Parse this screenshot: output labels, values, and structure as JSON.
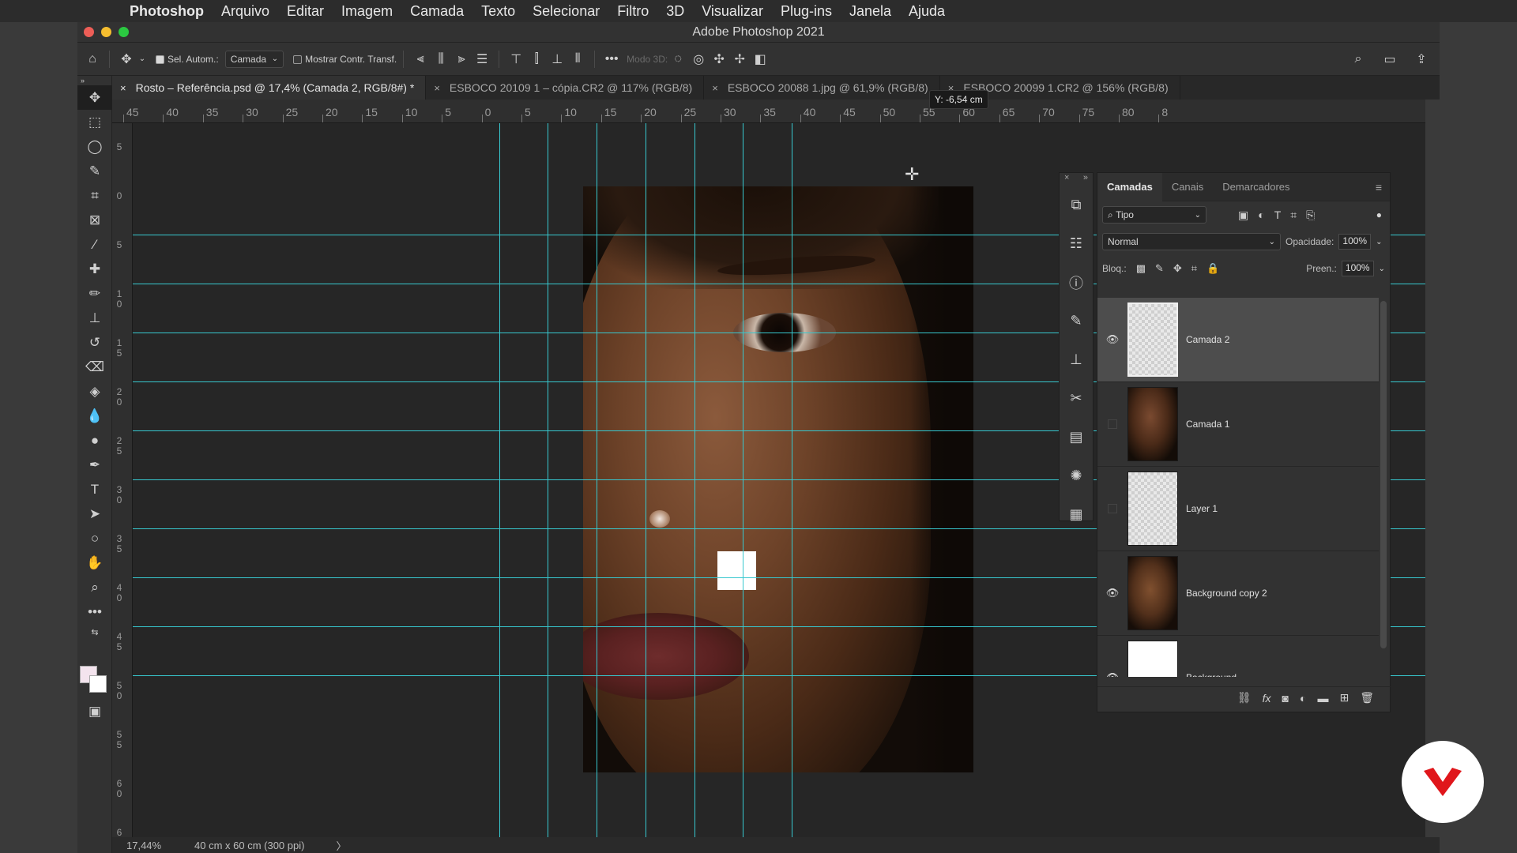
{
  "menubar": {
    "app_name": "Photoshop",
    "items": [
      "Arquivo",
      "Editar",
      "Imagem",
      "Camada",
      "Texto",
      "Selecionar",
      "Filtro",
      "3D",
      "Visualizar",
      "Plug-ins",
      "Janela",
      "Ajuda"
    ]
  },
  "window": {
    "title": "Adobe Photoshop 2021"
  },
  "options": {
    "auto_select_label": "Sel. Autom.:",
    "auto_select_target": "Camada",
    "show_transform_label": "Mostrar Contr. Transf.",
    "mode_3d_label": "Modo 3D:"
  },
  "tabs": [
    {
      "label": "Rosto – Referência.psd @ 17,4% (Camada 2, RGB/8#) *",
      "active": true
    },
    {
      "label": "ESBOCO 20109 1 – cópia.CR2 @ 117% (RGB/8)",
      "active": false
    },
    {
      "label": "ESBOCO 20088 1.jpg @ 61,9% (RGB/8)",
      "active": false
    },
    {
      "label": "ESBOCO 20099 1.CR2 @ 156% (RGB/8)",
      "active": false
    }
  ],
  "ruler_h_labels": [
    "45",
    "40",
    "35",
    "30",
    "25",
    "20",
    "15",
    "10",
    "5",
    "0",
    "5",
    "10",
    "15",
    "20",
    "25",
    "30",
    "35",
    "40",
    "45",
    "50",
    "55",
    "60",
    "65",
    "70",
    "75",
    "80",
    "8"
  ],
  "ruler_v_labels": [
    "5",
    "0",
    "5",
    "10",
    "15",
    "20",
    "25",
    "30",
    "35",
    "40",
    "45",
    "50",
    "55",
    "60",
    "6"
  ],
  "tooltip": "Y: -6,54 cm",
  "status": {
    "zoom": "17,44%",
    "doc_size": "40 cm x 60 cm (300 ppi)",
    "arrow": "〉"
  },
  "layers_panel": {
    "tabs": [
      "Camadas",
      "Canais",
      "Demarcadores"
    ],
    "filter_kind": "Tipo",
    "blend_mode": "Normal",
    "opacity_label": "Opacidade:",
    "opacity_value": "100%",
    "lock_label": "Bloq.:",
    "fill_label": "Preen.:",
    "fill_value": "100%",
    "layers": [
      {
        "name": "Camada 2",
        "visible": true,
        "selected": true,
        "thumb": "transparent"
      },
      {
        "name": "Camada 1",
        "visible": false,
        "selected": false,
        "thumb": "face1"
      },
      {
        "name": "Layer 1",
        "visible": false,
        "selected": false,
        "thumb": "transparent"
      },
      {
        "name": "Background copy 2",
        "visible": true,
        "selected": false,
        "thumb": "face2"
      },
      {
        "name": "Background",
        "visible": true,
        "selected": false,
        "thumb": "white",
        "locked": true
      }
    ]
  },
  "colors": {
    "guide": "#37c8cf",
    "brand_red": "#e0161b"
  }
}
